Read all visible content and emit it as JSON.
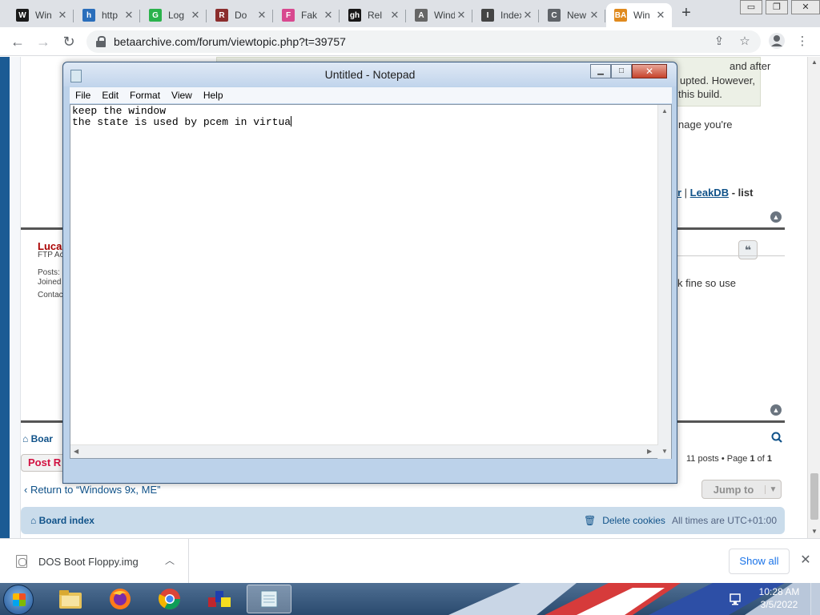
{
  "browser": {
    "tabs": [
      {
        "title": "Win",
        "favicon": "W",
        "color": "#1a1a1a"
      },
      {
        "title": "http",
        "favicon": "h",
        "color": "#2a6ebb"
      },
      {
        "title": "Log",
        "favicon": "G",
        "color": "#2bb24c"
      },
      {
        "title": "Do",
        "favicon": "R",
        "color": "#8b2d2d"
      },
      {
        "title": "Fak",
        "favicon": "F",
        "color": "#d8488f"
      },
      {
        "title": "Rel",
        "favicon": "gh",
        "color": "#181717"
      },
      {
        "title": "Windo",
        "favicon": "A",
        "color": "#666666"
      },
      {
        "title": "Index o",
        "favicon": "I",
        "color": "#444444"
      },
      {
        "title": "New Ta",
        "favicon": "C",
        "color": "#5f6368"
      },
      {
        "title": "Win",
        "favicon": "BA",
        "color": "#e08a1e"
      }
    ],
    "active_tab": 9,
    "new_tab": "+",
    "url": "betaarchive.com/forum/viewtopic.php?t=39757",
    "window_controls": [
      "▭",
      "❐",
      "✕"
    ]
  },
  "forum": {
    "post_fragment_1": "and after",
    "post_fragment_2": "upted. However,",
    "post_fragment_3": "this build.",
    "page_fragment": "nage you're",
    "link_or": "r",
    "link_sep": " | ",
    "link_leakdb": "LeakDB",
    "link_list": " - list",
    "author": "Lucas",
    "author_rank": "FTP Ac",
    "posts_label": "Posts:",
    "joined_label": "Joined",
    "contact_label": "Contac",
    "reply_fragment": "k fine so use",
    "breadcrumb": "Boar",
    "post_reply": "Post R",
    "posts_count_a": "11 posts • Page ",
    "page_current": "1",
    "posts_count_b": " of ",
    "page_total": "1",
    "return_link": "‹  Return to “Windows 9x, ME”",
    "jump_to": "Jump to",
    "footer_board_index": "Board index",
    "delete_cookies": "Delete cookies",
    "timezone": "All times are UTC+01:00"
  },
  "notepad": {
    "title": "Untitled - Notepad",
    "menus": [
      "File",
      "Edit",
      "Format",
      "View",
      "Help"
    ],
    "line1": "keep the window",
    "line2": "the state is used by pcem in virtua"
  },
  "downloads": {
    "file_name": "DOS Boot Floppy.img",
    "show_all": "Show all"
  },
  "taskbar": {
    "time": "10:28 AM",
    "date": "3/5/2022",
    "apps": [
      "file-explorer-icon",
      "firefox-icon",
      "chrome-icon",
      "winrar-icon",
      "notepad-icon"
    ]
  }
}
